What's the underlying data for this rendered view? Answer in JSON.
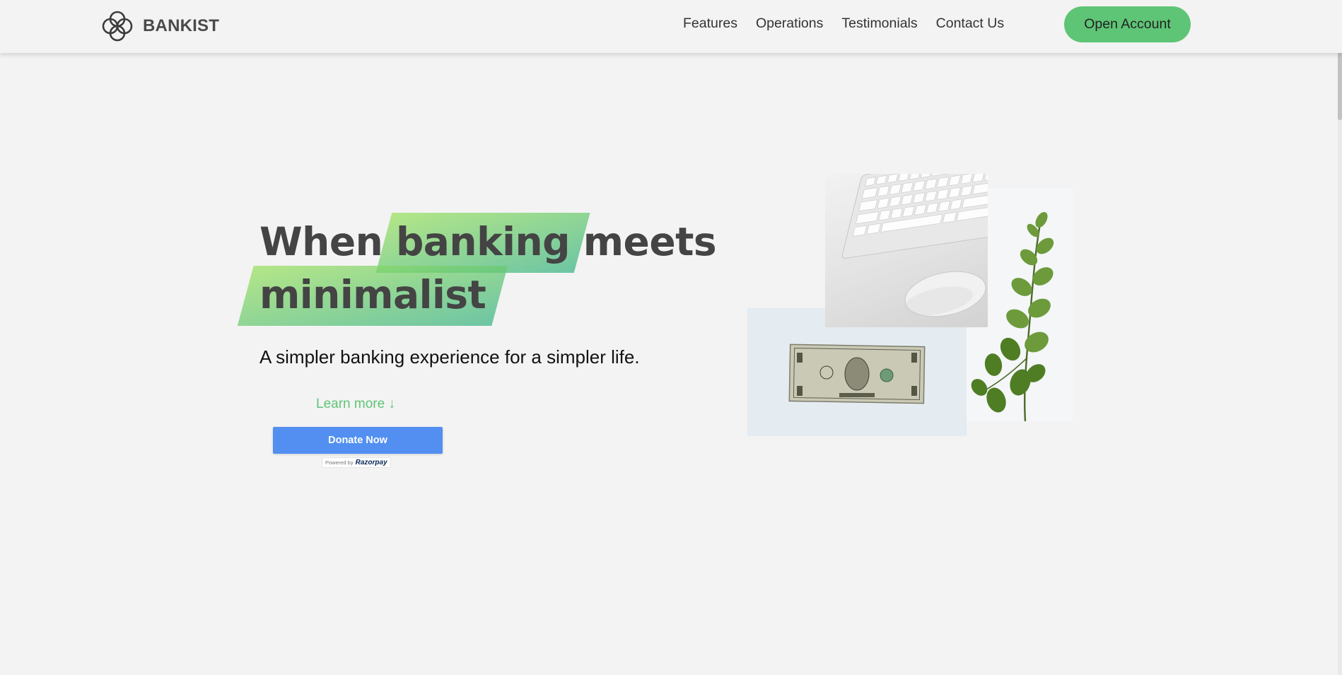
{
  "nav": {
    "brand_name": "BANKIST",
    "links": [
      "Features",
      "Operations",
      "Testimonials",
      "Contact Us"
    ],
    "cta_label": "Open Account"
  },
  "hero": {
    "title_word_1": "When",
    "title_highlight_1": "banking",
    "title_word_2": "meets",
    "title_highlight_2": "minimalist",
    "subtitle": "A simpler banking experience for a simpler life.",
    "learn_more": "Learn more ↓"
  },
  "donate": {
    "button_label": "Donate Now",
    "powered_by": "Powered by",
    "powered_brand": "Razorpay"
  },
  "colors": {
    "accent": "#5ec576",
    "highlight_from": "#9be15d",
    "highlight_to": "#39b385",
    "donate_button": "#528ff0",
    "background": "#f3f3f3"
  }
}
